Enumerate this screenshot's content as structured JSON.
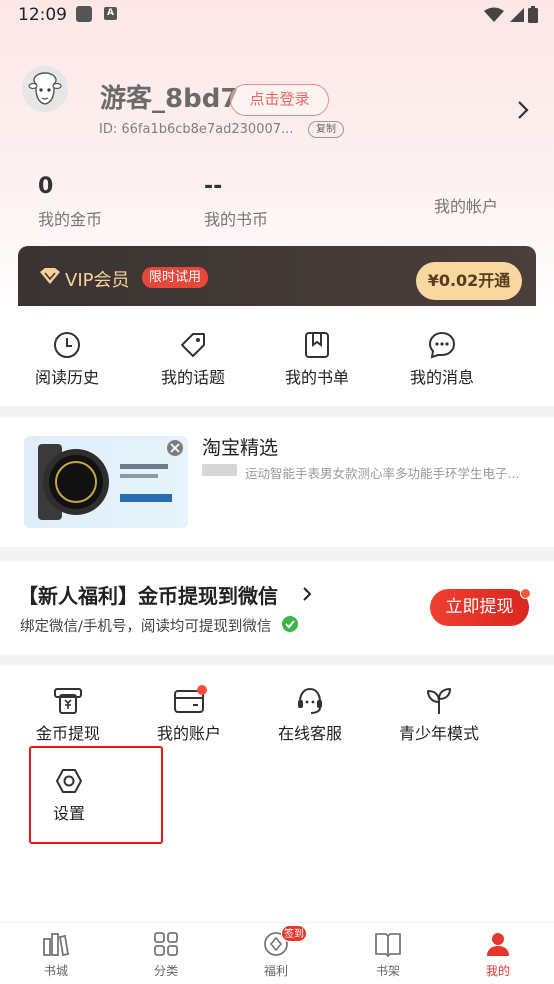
{
  "status_bar": {
    "time": "12:09"
  },
  "profile": {
    "username": "游客_8bd7",
    "login_label": "点击登录",
    "user_id": "ID: 66fa1b6cb8e7ad230007...",
    "copy_label": "复制"
  },
  "stats": [
    {
      "value": "0",
      "label": "我的金币"
    },
    {
      "value": "--",
      "label": "我的书币"
    },
    {
      "label": "我的帐户"
    }
  ],
  "vip": {
    "title": "VIP会员",
    "tag": "限时试用",
    "button": "¥0.02开通"
  },
  "shortcuts": [
    {
      "label": "阅读历史",
      "icon": "clock-icon"
    },
    {
      "label": "我的话题",
      "icon": "tag-icon"
    },
    {
      "label": "我的书单",
      "icon": "bookmark-icon"
    },
    {
      "label": "我的消息",
      "icon": "chat-icon"
    }
  ],
  "ad": {
    "title": "淘宝精选",
    "description": "运动智能手表男女款测心率多功能手环学生电子..."
  },
  "promo": {
    "title": "【新人福利】金币提现到微信",
    "subtitle": "绑定微信/手机号，阅读均可提现到微信",
    "button": "立即提现"
  },
  "tools": [
    {
      "label": "金币提现",
      "icon": "withdraw-icon"
    },
    {
      "label": "我的账户",
      "icon": "wallet-icon"
    },
    {
      "label": "在线客服",
      "icon": "headset-icon"
    },
    {
      "label": "青少年模式",
      "icon": "sprout-icon"
    },
    {
      "label": "设置",
      "icon": "settings-icon"
    }
  ],
  "bottom_nav": [
    {
      "label": "书城",
      "icon": "bookstore-icon"
    },
    {
      "label": "分类",
      "icon": "grid-icon"
    },
    {
      "label": "福利",
      "icon": "coin-icon",
      "badge": "签到"
    },
    {
      "label": "书架",
      "icon": "bookshelf-icon"
    },
    {
      "label": "我的",
      "icon": "person-icon",
      "active": true
    }
  ],
  "colors": {
    "accent": "#e5362c",
    "vip_gold": "#f6d29a",
    "vip_bg": "#3a3331"
  }
}
